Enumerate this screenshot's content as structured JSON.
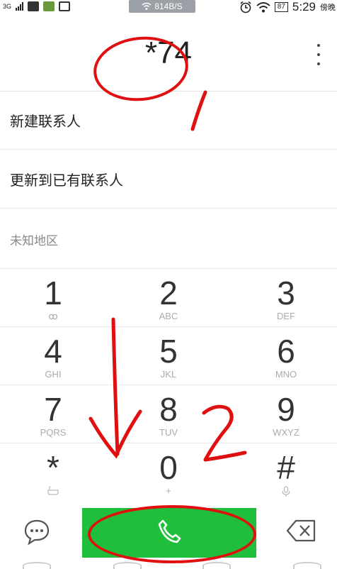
{
  "status_bar": {
    "network": "3G",
    "speed": "814B/S",
    "battery": "87",
    "time": "5:29",
    "extra": "傍晚"
  },
  "dialer": {
    "dialed_number": "*74",
    "options": [
      "新建联系人",
      "更新到已有联系人"
    ],
    "region": "未知地区"
  },
  "keypad": [
    [
      {
        "digit": "1",
        "letters": "ꝏ"
      },
      {
        "digit": "2",
        "letters": "ABC"
      },
      {
        "digit": "3",
        "letters": "DEF"
      }
    ],
    [
      {
        "digit": "4",
        "letters": "GHI"
      },
      {
        "digit": "5",
        "letters": "JKL"
      },
      {
        "digit": "6",
        "letters": "MNO"
      }
    ],
    [
      {
        "digit": "7",
        "letters": "PQRS"
      },
      {
        "digit": "8",
        "letters": "TUV"
      },
      {
        "digit": "9",
        "letters": "WXYZ"
      }
    ],
    [
      {
        "digit": "*",
        "letters": ""
      },
      {
        "digit": "0",
        "letters": "+"
      },
      {
        "digit": "#",
        "letters": ""
      }
    ]
  ],
  "annotations": {
    "mark1": "1",
    "mark2": "2",
    "color": "#e01010"
  },
  "colors": {
    "call_green": "#1fbf3c",
    "annotation_red": "#e01010"
  }
}
